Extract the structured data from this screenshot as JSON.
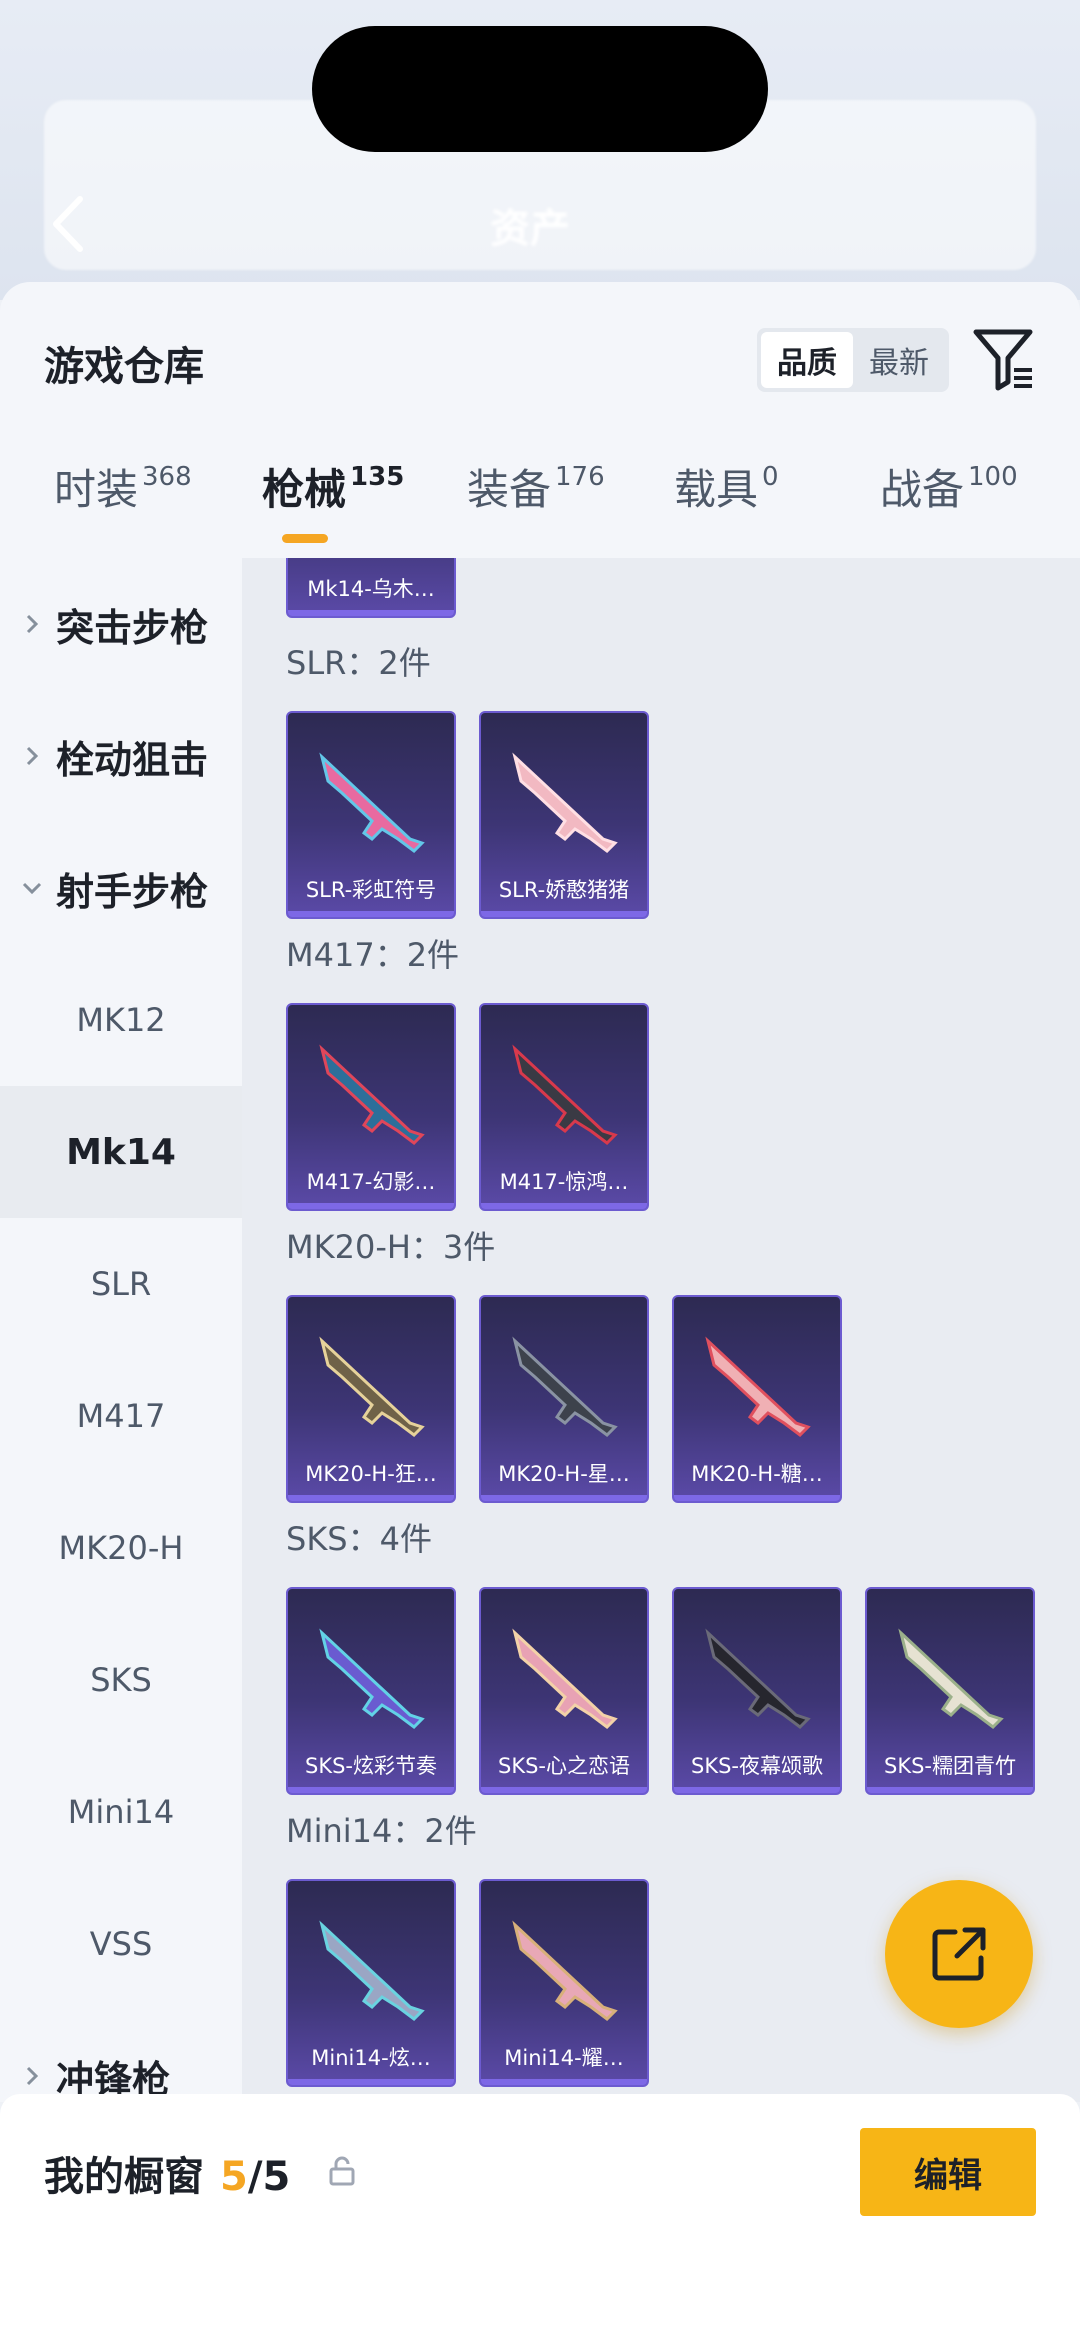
{
  "header": {
    "page_title": "资产"
  },
  "sheet": {
    "title": "游戏仓库",
    "sort_options": [
      "品质",
      "最新"
    ],
    "tabs": [
      {
        "label": "时装",
        "count": "368"
      },
      {
        "label": "枪械",
        "count": "135"
      },
      {
        "label": "装备",
        "count": "176"
      },
      {
        "label": "载具",
        "count": "0"
      },
      {
        "label": "战备",
        "count": "100"
      }
    ]
  },
  "sidebar": {
    "groups": [
      "突击步枪",
      "栓动狙击",
      "射手步枪",
      "冲锋枪"
    ],
    "subs": [
      "MK12",
      "Mk14",
      "SLR",
      "M417",
      "MK20-H",
      "SKS",
      "Mini14",
      "VSS"
    ]
  },
  "content": {
    "top_card": "Mk14-乌木…",
    "sections": [
      {
        "title": "SLR：2件",
        "items": [
          "SLR-彩虹符号",
          "SLR-娇憨猪猪"
        ]
      },
      {
        "title": "M417：2件",
        "items": [
          "M417-幻影…",
          "M417-惊鸿…"
        ]
      },
      {
        "title": "MK20-H：3件",
        "items": [
          "MK20-H-狂…",
          "MK20-H-星…",
          "MK20-H-糖…"
        ]
      },
      {
        "title": "SKS：4件",
        "items": [
          "SKS-炫彩节奏",
          "SKS-心之恋语",
          "SKS-夜幕颂歌",
          "SKS-糯团青竹"
        ]
      },
      {
        "title": "Mini14：2件",
        "items": [
          "Mini14-炫…",
          "Mini14-耀…"
        ]
      }
    ]
  },
  "bottom": {
    "title": "我的橱窗",
    "count_current": "5",
    "count_total": "/5",
    "edit_label": "编辑"
  },
  "colors": {
    "accent": "#f5a623",
    "card_bg": "#3d3575",
    "card_border": "#6c5bd0"
  }
}
